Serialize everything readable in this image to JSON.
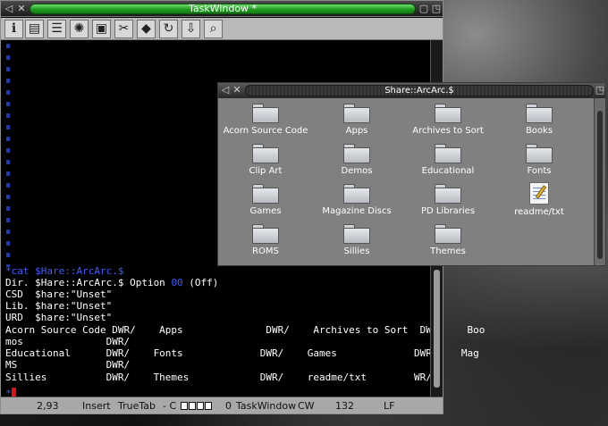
{
  "colors": {
    "title_active": "#1f9a1f",
    "terminal_bg": "#000000",
    "terminal_accent": "#3c5cff",
    "cursor": "#e01010"
  },
  "taskwindow": {
    "title": "TaskWindow *",
    "toolbar_icons": [
      "info-icon",
      "taskwindow-icon",
      "books-icon",
      "gear-icon",
      "save-disk-icon",
      "close-task-icon",
      "suspend-icon",
      "refresh-icon",
      "download-icon",
      "find-icon"
    ],
    "terminal_lines": [
      {
        "white": "",
        "blue": "*cat $Hare::ArcArc.$"
      },
      {
        "white": "Dir. $Hare::ArcArc.$ Option ",
        "blue": "00",
        "tail": " (Off)"
      },
      {
        "white": "CSD  $hare:\"Unset\"",
        "blue": ""
      },
      {
        "white": "Lib. $hare:\"Unset\"",
        "blue": ""
      },
      {
        "white": "URD  $hare:\"Unset\"",
        "blue": ""
      },
      {
        "white": "Acorn Source Code DWR/    Apps              DWR/    Archives to Sort  DWR/    Boo",
        "blue": ""
      },
      {
        "white": "mos              DWR/",
        "blue": ""
      },
      {
        "white": "Educational      DWR/    Fonts             DWR/    Games             DWR/    Mag",
        "blue": ""
      },
      {
        "white": "MS               DWR/",
        "blue": ""
      },
      {
        "white": "Sillies          DWR/    Themes            DWR/    readme/txt        WR/",
        "blue": ""
      }
    ],
    "prompt": "*",
    "status": {
      "position": "2,93",
      "mode": "Insert",
      "tab": "TrueTab",
      "dash_c": "- C",
      "zero": "0",
      "app": "TaskWindow",
      "cw": "CW",
      "count": "132",
      "newline": "LF"
    }
  },
  "filer": {
    "title": "Share::ArcArc.$",
    "items": [
      {
        "label": "Acorn Source Code",
        "icon": "folder-icon"
      },
      {
        "label": "Apps",
        "icon": "folder-icon"
      },
      {
        "label": "Archives to Sort",
        "icon": "folder-icon"
      },
      {
        "label": "Books",
        "icon": "folder-icon"
      },
      {
        "label": "Clip Art",
        "icon": "folder-icon"
      },
      {
        "label": "Demos",
        "icon": "folder-icon"
      },
      {
        "label": "Educational",
        "icon": "folder-icon"
      },
      {
        "label": "Fonts",
        "icon": "folder-icon"
      },
      {
        "label": "Games",
        "icon": "folder-icon"
      },
      {
        "label": "Magazine Discs",
        "icon": "folder-icon"
      },
      {
        "label": "PD Libraries",
        "icon": "folder-icon"
      },
      {
        "label": "readme/txt",
        "icon": "text-file-icon"
      },
      {
        "label": "ROMS",
        "icon": "folder-icon"
      },
      {
        "label": "Sillies",
        "icon": "folder-icon"
      },
      {
        "label": "Themes",
        "icon": "folder-icon"
      }
    ]
  }
}
